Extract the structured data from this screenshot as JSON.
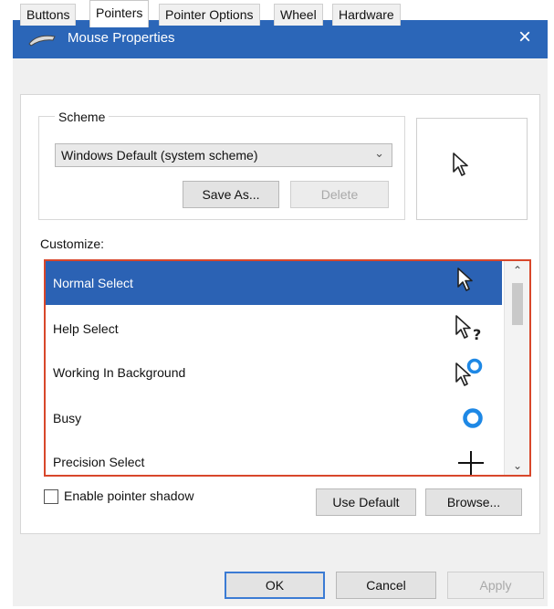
{
  "window": {
    "title": "Mouse Properties",
    "close_glyph": "×"
  },
  "tabs": [
    {
      "label": "Buttons"
    },
    {
      "label": "Pointers"
    },
    {
      "label": "Pointer Options"
    },
    {
      "label": "Wheel"
    },
    {
      "label": "Hardware"
    }
  ],
  "active_tab": "Pointers",
  "scheme": {
    "label": "Scheme",
    "selected": "Windows Default (system scheme)",
    "save_as": "Save As...",
    "delete": "Delete"
  },
  "preview": {
    "icon": "arrow-cursor-icon"
  },
  "customize": {
    "label": "Customize:",
    "items": [
      {
        "label": "Normal Select",
        "icon": "arrow-cursor-icon",
        "selected": true
      },
      {
        "label": "Help Select",
        "icon": "help-cursor-icon"
      },
      {
        "label": "Working In Background",
        "icon": "working-cursor-icon"
      },
      {
        "label": "Busy",
        "icon": "busy-cursor-icon"
      },
      {
        "label": "Precision Select",
        "icon": "crosshair-cursor-icon"
      }
    ]
  },
  "shadow": {
    "label": "Enable pointer shadow",
    "checked": false
  },
  "buttons": {
    "use_default": "Use Default",
    "browse": "Browse...",
    "ok": "OK",
    "cancel": "Cancel",
    "apply": "Apply"
  },
  "colors": {
    "titlebar": "#2b66b8",
    "selection": "#2b62b4",
    "list_border": "#d8472b",
    "busy_ring": "#1e88e5"
  }
}
